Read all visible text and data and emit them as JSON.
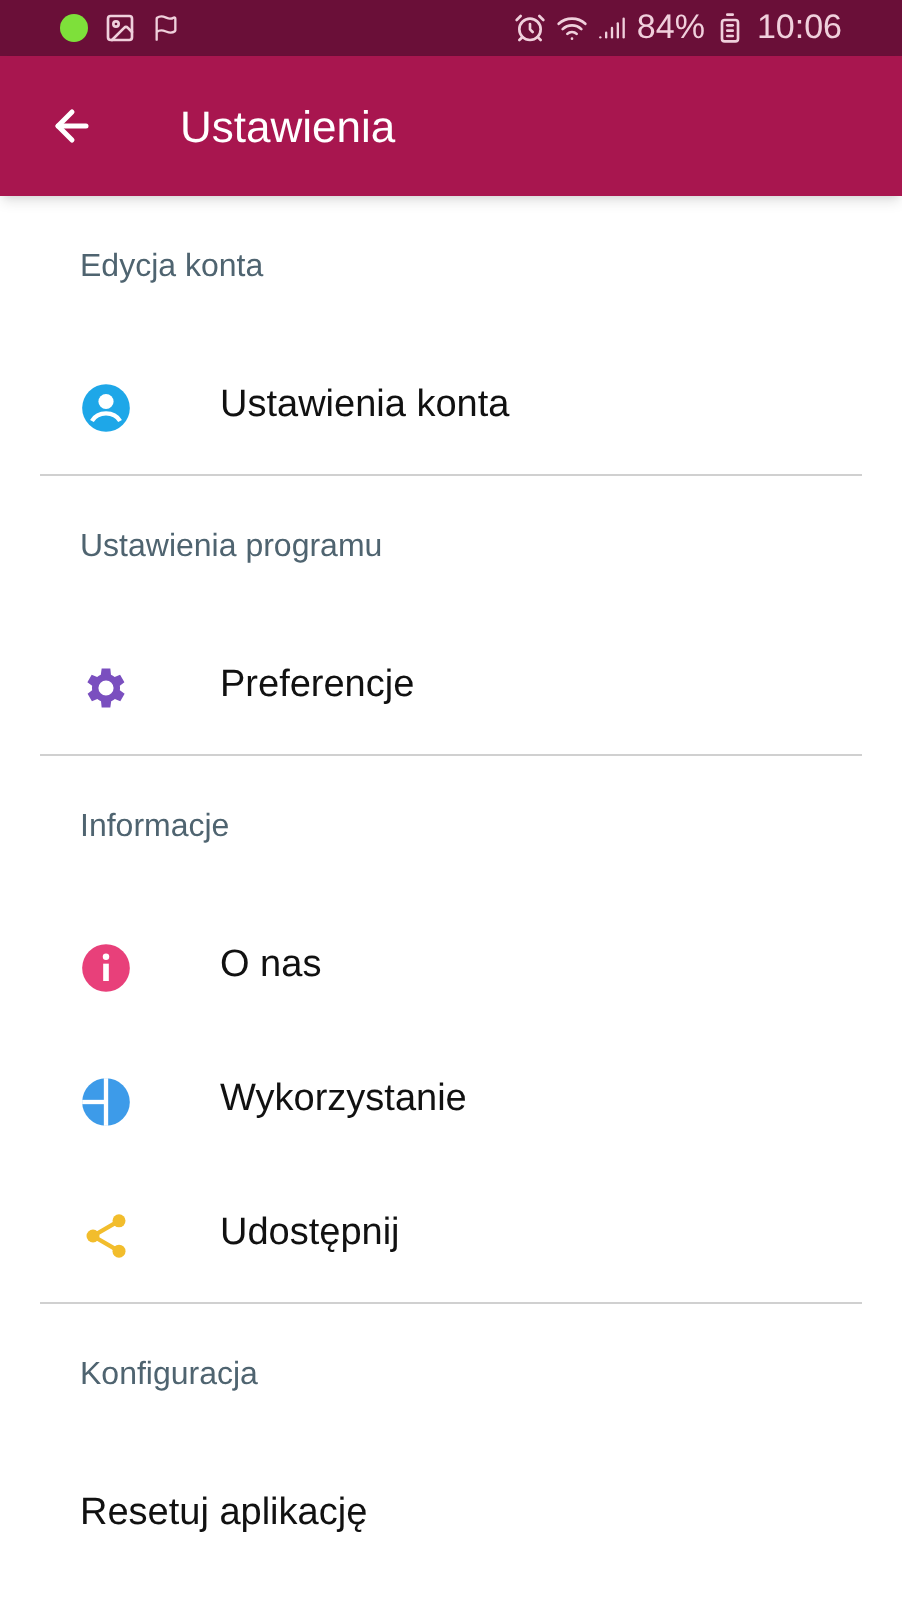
{
  "status_bar": {
    "battery": "84%",
    "time": "10:06"
  },
  "app_bar": {
    "title": "Ustawienia"
  },
  "sections": [
    {
      "header": "Edycja konta",
      "items": [
        {
          "label": "Ustawienia konta",
          "kind": "account",
          "color": "#1ea7e8"
        }
      ]
    },
    {
      "header": "Ustawienia programu",
      "items": [
        {
          "label": "Preferencje",
          "kind": "settings",
          "color": "#7a4fbf"
        }
      ]
    },
    {
      "header": "Informacje",
      "items": [
        {
          "label": "O nas",
          "kind": "info",
          "color": "#e8407a"
        },
        {
          "label": "Wykorzystanie",
          "kind": "usage",
          "color": "#3d9be9"
        },
        {
          "label": "Udostępnij",
          "kind": "share",
          "color": "#f2bd2c"
        }
      ]
    },
    {
      "header": "Konfiguracja",
      "items": [
        {
          "label": "Resetuj aplikację",
          "kind": "plain"
        }
      ]
    }
  ]
}
